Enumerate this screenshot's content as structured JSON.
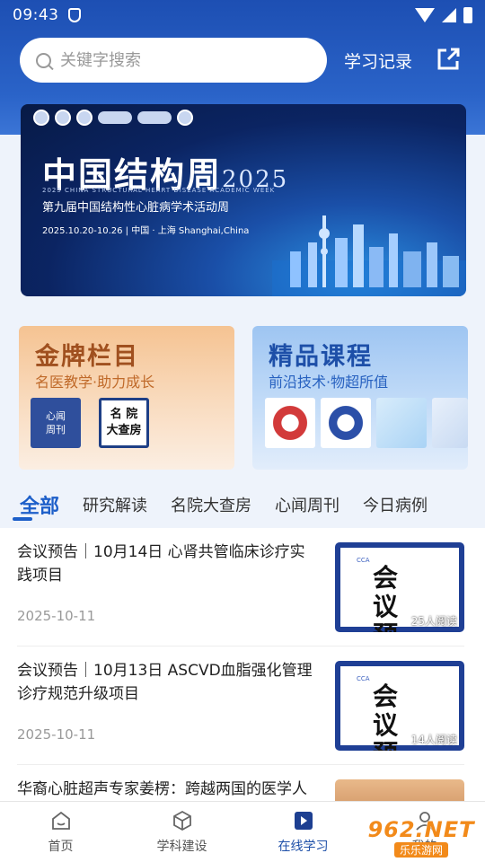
{
  "status_bar": {
    "time": "09:43"
  },
  "header": {
    "search_placeholder": "关键字搜索",
    "study_record_label": "学习记录"
  },
  "banner": {
    "title": "中国结构周",
    "year": "2025",
    "subtitle_en": "2025 CHINA STRUCTURAL HEART DISEASE ACADEMIC WEEK",
    "subtitle_cn": "第九届中国结构性心脏病学术活动周",
    "date_line": "2025.10.20-10.26 | 中国 · 上海 Shanghai,China"
  },
  "cards": [
    {
      "title": "金牌栏目",
      "subtitle": "名医教学·助力成长",
      "thumbs": [
        {
          "text_line1": "心闻",
          "text_line2": "周刊"
        },
        {
          "text_line1": "名 院",
          "text_line2": "大查房"
        }
      ]
    },
    {
      "title": "精品课程",
      "subtitle": "前沿技术·物超所值"
    }
  ],
  "tabs": [
    "全部",
    "研究解读",
    "名院大查房",
    "心闻周刊",
    "今日病例"
  ],
  "articles": [
    {
      "title": "会议预告｜10月14日 心肾共管临床诊疗实践项目",
      "date": "2025-10-11",
      "thumb_text_line1": "会 议",
      "thumb_text_line2": "预 告",
      "thumb_logo": "CCA",
      "reads": "25人阅读"
    },
    {
      "title": "会议预告｜10月13日 ASCVD血脂强化管理诊疗规范升级项目",
      "date": "2025-10-11",
      "thumb_text_line1": "会 议",
      "thumb_text_line2": "预 告",
      "thumb_logo": "CCA",
      "reads": "14人阅读"
    },
    {
      "title": "华裔心脏超声专家姜楞：跨越两国的医学人生路上永在探索，专"
    }
  ],
  "bottom_nav": [
    {
      "label": "首页",
      "icon": "home-icon"
    },
    {
      "label": "学科建设",
      "icon": "cube-icon"
    },
    {
      "label": "在线学习",
      "icon": "play-icon"
    },
    {
      "label": "我的",
      "icon": "person-icon"
    }
  ],
  "watermark": {
    "top": "962.NET",
    "bottom": "乐乐游网"
  },
  "colors": {
    "primary": "#1d4fb3",
    "accent": "#1d5fc9",
    "gold": "#a0501f"
  }
}
